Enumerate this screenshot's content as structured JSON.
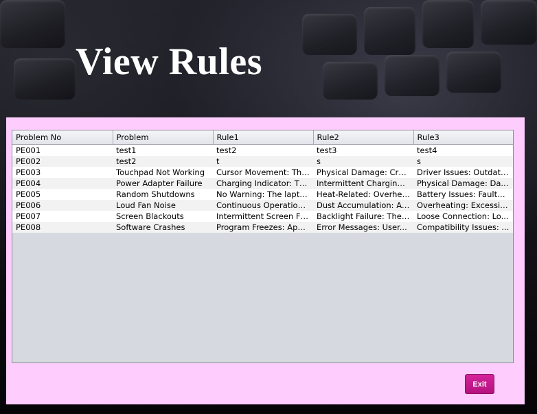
{
  "header": {
    "title": "View Rules"
  },
  "table": {
    "columns": [
      "Problem No",
      "Problem",
      "Rule1",
      "Rule2",
      "Rule3"
    ],
    "rows": [
      [
        "PE001",
        "test1",
        "test2",
        "test3",
        "test4"
      ],
      [
        "PE002",
        "test2",
        "t",
        "s",
        "s"
      ],
      [
        "PE003",
        "Touchpad Not Working",
        "Cursor Movement: The ...",
        "Physical Damage: Cra...",
        "Driver Issues: Outdate..."
      ],
      [
        "PE004",
        "Power Adapter Failure",
        "Charging Indicator: Th...",
        "Intermittent Charging: ...",
        "Physical Damage: Da..."
      ],
      [
        "PE005",
        "Random Shutdowns",
        "No Warning: The lapto...",
        "Heat-Related: Overhea...",
        "Battery Issues: Faulty b..."
      ],
      [
        "PE006",
        "Loud Fan Noise",
        "Continuous Operation: ...",
        "Dust Accumulation: Ac...",
        "Overheating: Excessiv..."
      ],
      [
        "PE007",
        "Screen Blackouts",
        "Intermittent Screen Flic...",
        "Backlight Failure: The ...",
        "Loose Connection: Lo..."
      ],
      [
        "PE008",
        "Software Crashes",
        "Program Freezes: Appl...",
        "Error Messages: User...",
        "Compatibility Issues: ..."
      ]
    ]
  },
  "actions": {
    "exit_label": "Exit"
  },
  "colors": {
    "panel_bg": "#fecdfe",
    "exit_button": "#c41a8e",
    "table_empty_area": "#d6d9df"
  }
}
